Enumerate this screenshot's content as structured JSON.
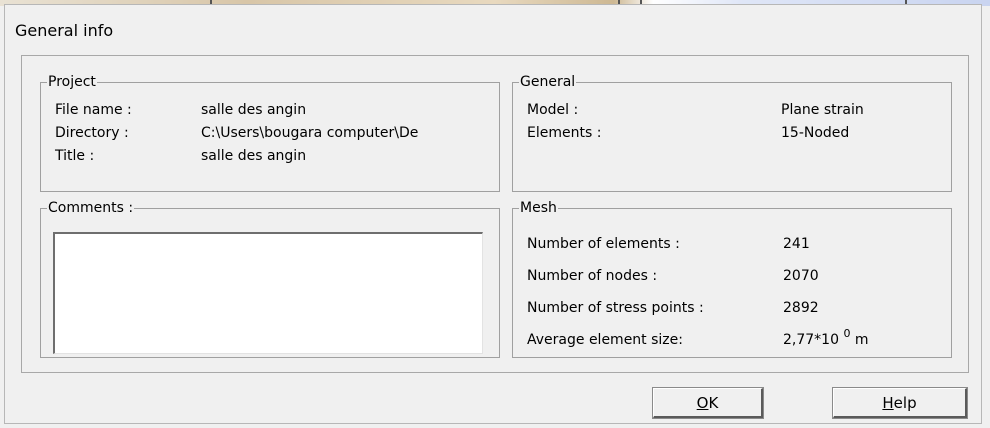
{
  "dialog": {
    "title": "General info"
  },
  "project": {
    "legend": "Project",
    "file_name_label": "File name :",
    "file_name_value": "salle des angin",
    "directory_label": "Directory :",
    "directory_value": "C:\\Users\\bougara computer\\De",
    "title_label": "Title :",
    "title_value": "salle des angin"
  },
  "general": {
    "legend": "General",
    "model_label": "Model :",
    "model_value": "Plane strain",
    "elements_label": "Elements :",
    "elements_value": "15-Noded"
  },
  "comments": {
    "legend": "Comments :",
    "value": ""
  },
  "mesh": {
    "legend": "Mesh",
    "num_elements_label": "Number of elements :",
    "num_elements_value": "241",
    "num_nodes_label": "Number of nodes :",
    "num_nodes_value": "2070",
    "num_stress_label": "Number of stress points :",
    "num_stress_value": "2892",
    "avg_size_label": "Average element size:",
    "avg_size_mantissa": "2,77*10",
    "avg_size_exponent": "0",
    "avg_size_unit": "m"
  },
  "buttons": {
    "ok_mnemonic": "O",
    "ok_rest": "K",
    "help_mnemonic": "H",
    "help_rest": "elp"
  }
}
